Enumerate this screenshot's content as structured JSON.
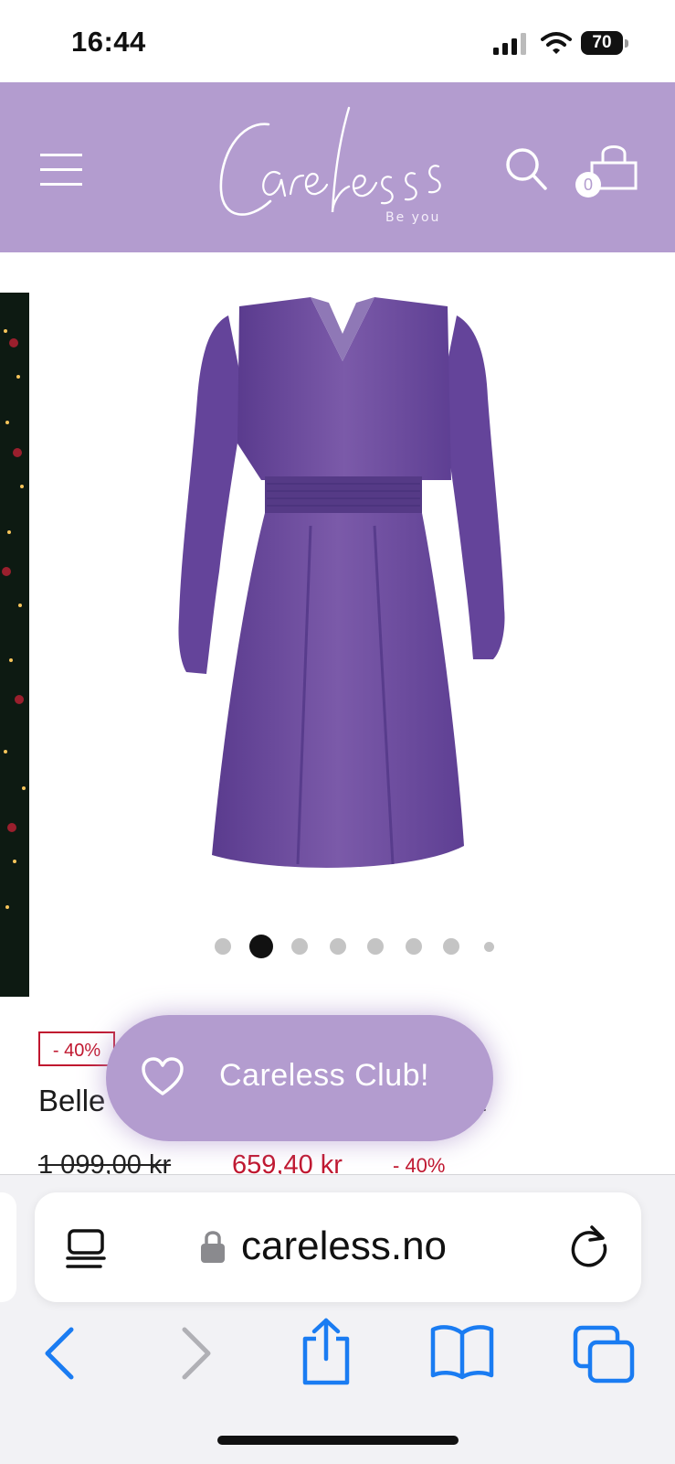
{
  "status_bar": {
    "time": "16:44",
    "battery": "70"
  },
  "header": {
    "brand_name": "Careless",
    "brand_tagline": "Be you",
    "cart_count": "0",
    "background_color": "#b39ccf"
  },
  "gallery": {
    "image_subject": "purple-wrap-dress",
    "dot_count": 8,
    "active_index": 1
  },
  "product": {
    "discount_badge": "- 40%",
    "title_left": "Belle",
    "title_right": "a",
    "old_price": "1 099,00 kr",
    "new_price": "659,40 kr",
    "price_discount": "- 40%",
    "sale_color": "#c0172f"
  },
  "club_button": {
    "label": "Careless Club!"
  },
  "browser": {
    "url": "careless.no",
    "accent_color": "#1a7cf2",
    "icons": [
      "reader-icon",
      "lock-icon",
      "reload-icon",
      "back-icon",
      "forward-icon",
      "share-icon",
      "bookmarks-icon",
      "tabs-icon"
    ]
  }
}
